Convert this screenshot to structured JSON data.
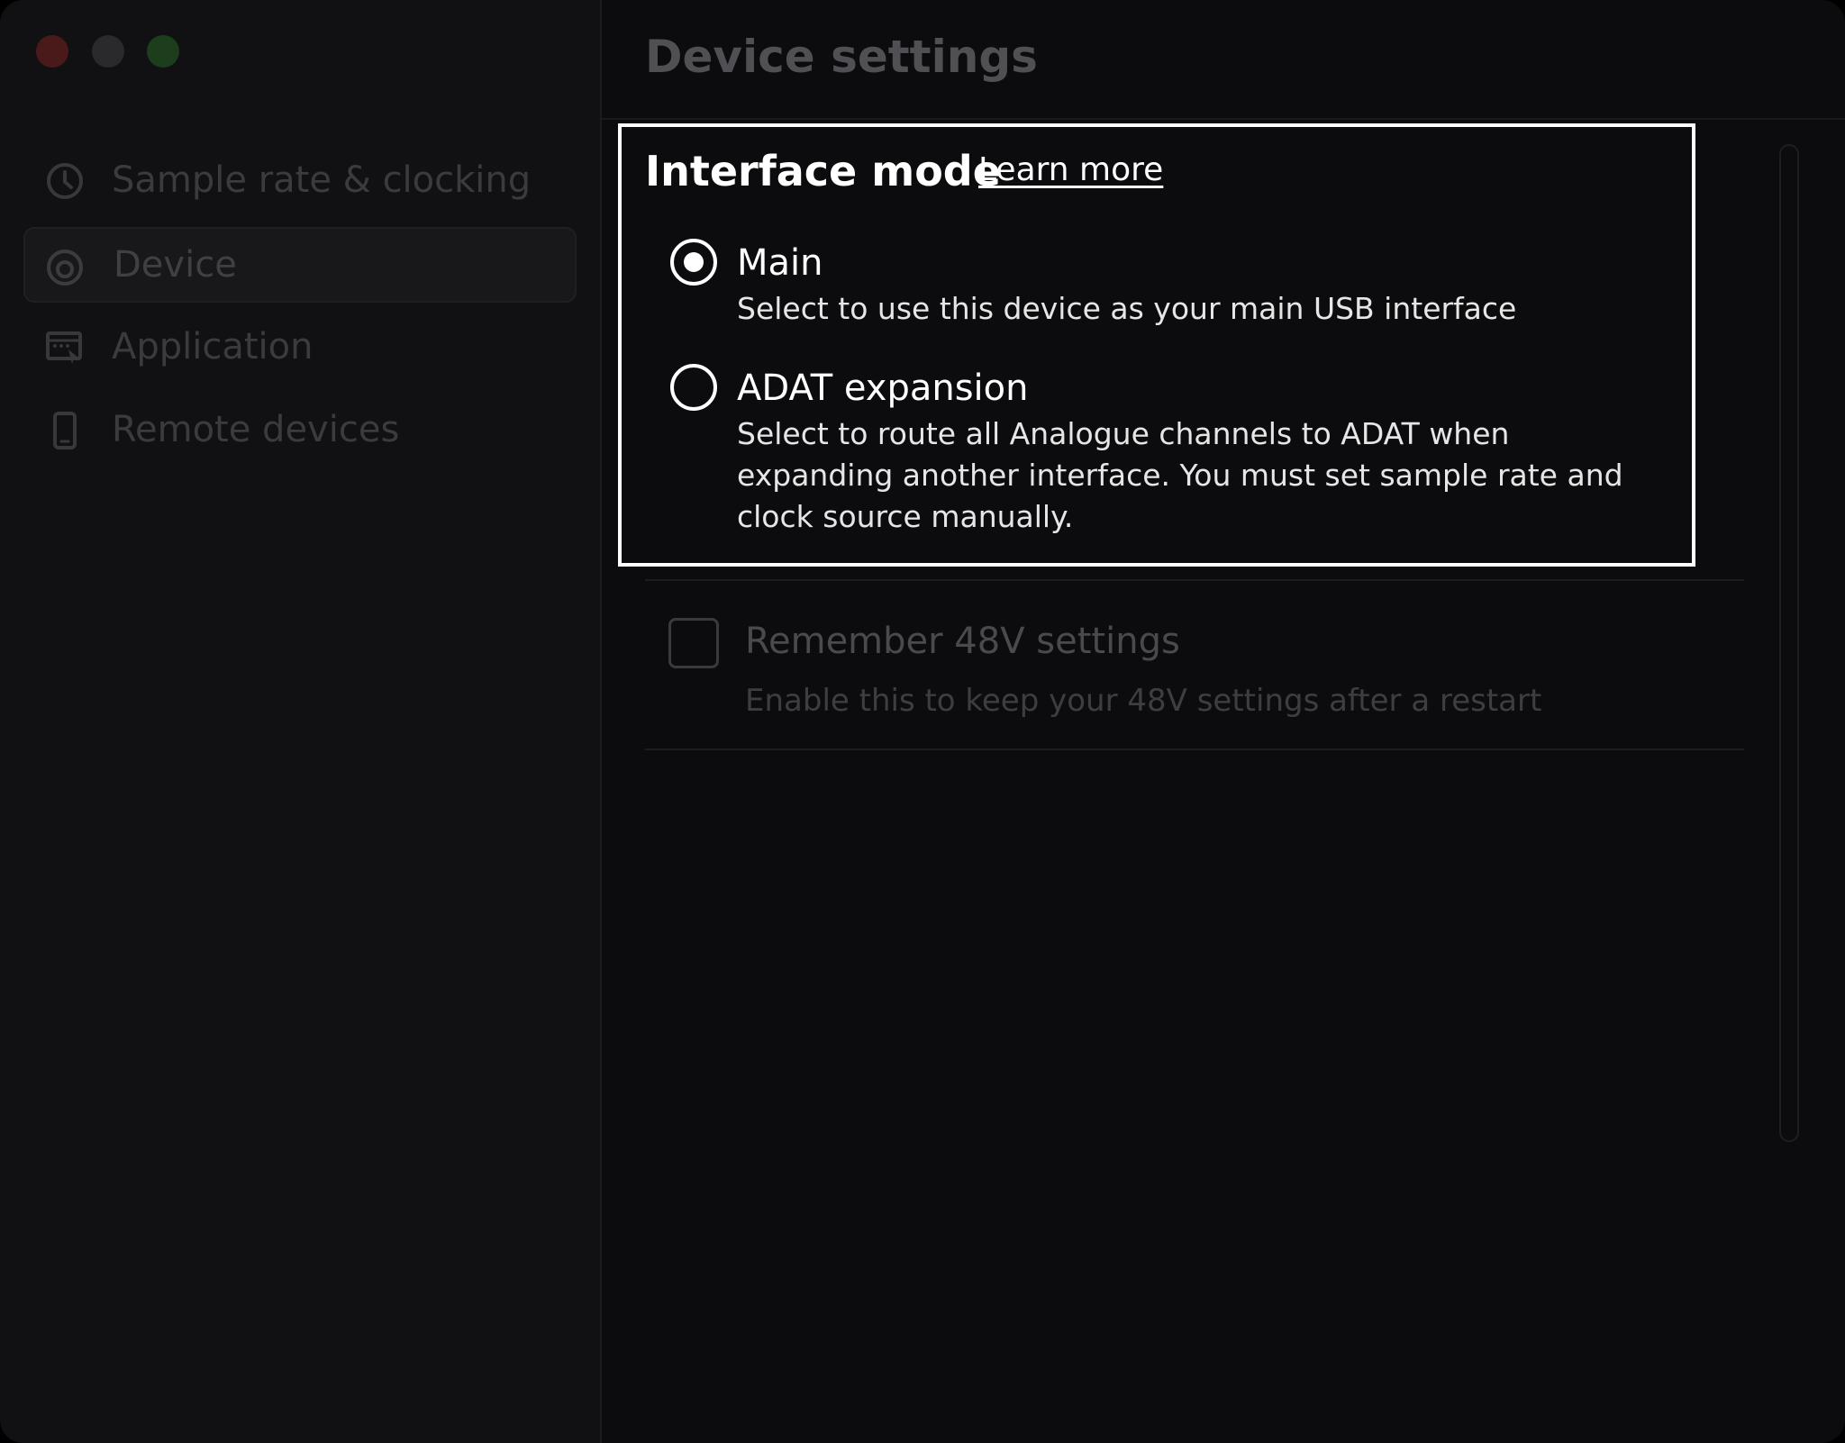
{
  "window": {
    "controls": [
      "close",
      "minimize",
      "maximize"
    ],
    "control_colors": {
      "close": "#4a1a1a",
      "minimize": "#2a2a2c",
      "maximize": "#1c3e1c"
    }
  },
  "sidebar": {
    "items": [
      {
        "label": "Sample rate & clocking",
        "icon": "clock-icon",
        "active": false
      },
      {
        "label": "Device",
        "icon": "device-icon",
        "active": true
      },
      {
        "label": "Application",
        "icon": "application-icon",
        "active": false
      },
      {
        "label": "Remote devices",
        "icon": "phone-icon",
        "active": false
      }
    ],
    "text_color": "#3b3b3f",
    "active_text_color": "#404044"
  },
  "main": {
    "title": "Device settings",
    "title_color": "#505054",
    "interface_mode": {
      "title": "Interface mode",
      "learn_more": "Learn more",
      "options": [
        {
          "label": "Main",
          "description": "Select to use this device as your main USB interface",
          "selected": true
        },
        {
          "label": "ADAT expansion",
          "description": "Select to route all Analogue channels to ADAT when expanding another interface. You must set sample rate and clock source manually.",
          "selected": false
        }
      ]
    },
    "remember_48v": {
      "label": "Remember 48V settings",
      "description": "Enable this to keep your 48V settings after a restart",
      "checked": false
    }
  }
}
